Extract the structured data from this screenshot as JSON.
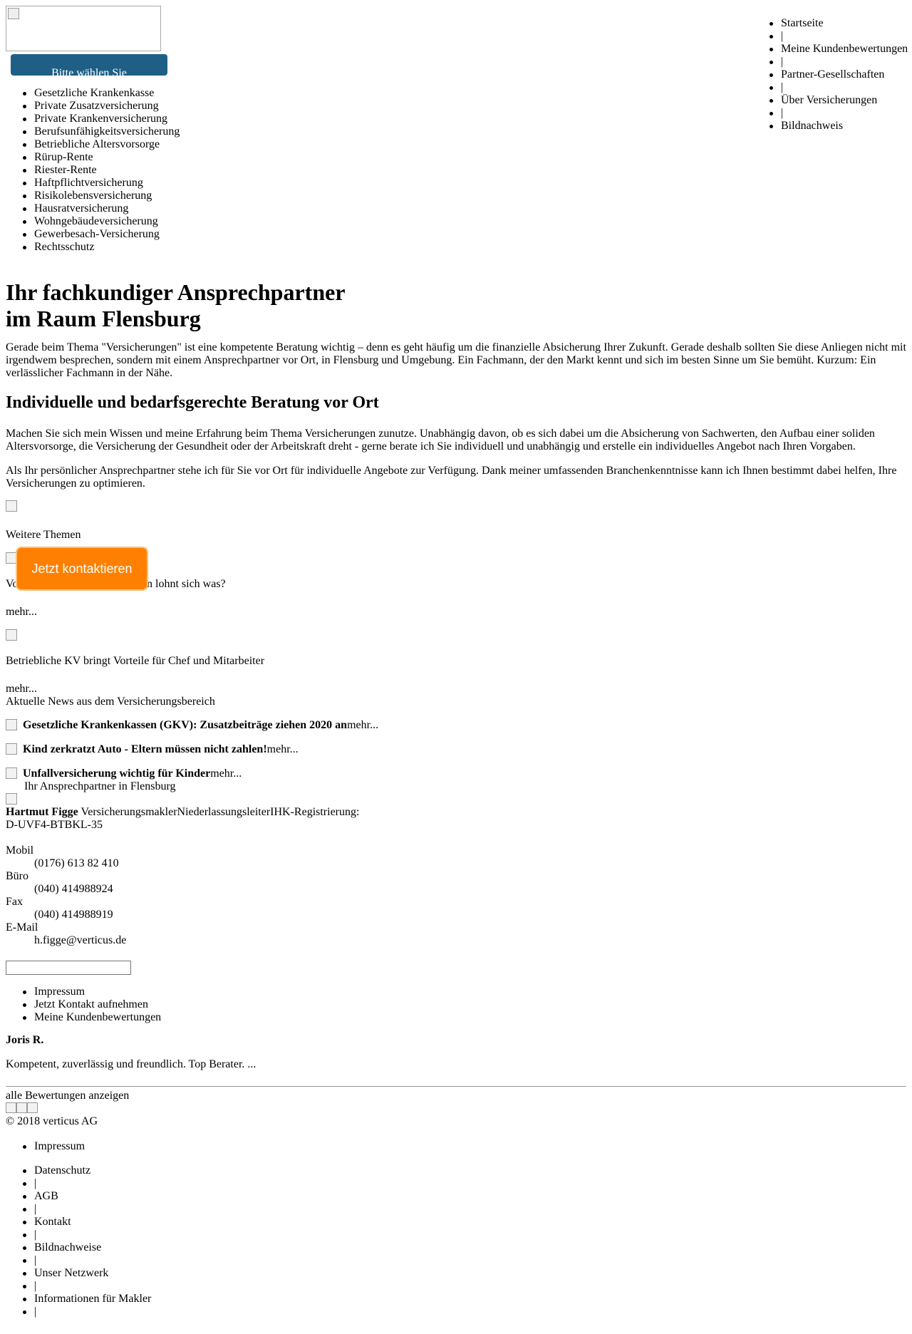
{
  "header": {
    "select_label": "Bitte wählen Sie"
  },
  "main_nav": [
    "Startseite",
    "|",
    "Meine Kundenbewertungen",
    "|",
    "Partner-Gesellschaften",
    "|",
    "Über Versicherungen",
    "|",
    "Bildnachweis"
  ],
  "sidebar_nav": [
    "Gesetzliche Krankenkasse",
    "Private Zusatzversicherung",
    "Private Krankenversicherung",
    "Berufsunfähigkeitsversicherung",
    "Betriebliche Altersvorsorge",
    "Rürup-Rente",
    "Riester-Rente",
    "Haftpflichtversicherung",
    "Risikolebensversicherung",
    "Hausratversicherung",
    "Wohngebäudeversicherung",
    "Gewerbesach-Versicherung",
    "Rechtsschutz"
  ],
  "hero": {
    "title_line1": "Ihr fachkundiger Ansprechpartner",
    "title_line2": "im Raum Flensburg",
    "intro": "Gerade beim Thema \"Versicherungen\" ist eine kompetente Beratung wichtig – denn es geht häufig um die finanzielle Absicherung Ihrer Zukunft. Gerade deshalb sollten Sie diese Anliegen nicht mit irgendwem besprechen, sondern mit einem Ansprechpartner vor Ort, in Flensburg und Umgebung. Ein Fachmann, der den Markt kennt und sich im besten Sinne um Sie bemüht. Kurzum: Ein verlässlicher Fachmann in der Nähe."
  },
  "section": {
    "heading": "Individuelle und bedarfsgerechte Beratung vor Ort",
    "para1": "Machen Sie sich mein Wissen und meine Erfahrung beim Thema Versicherungen zunutze. Unabhängig davon, ob es sich dabei um die Absicherung von Sachwerten, den Aufbau einer soliden Altersvorsorge, die Versicherung der Gesundheit oder der Arbeitskraft dreht - gerne berate ich Sie individuell und unabhängig und erstelle ein individuelles Angebot nach Ihren Vorgaben.",
    "para2": "Als Ihr persönlicher Ansprechpartner stehe ich für Sie vor Ort für individuelle Angebote zur Verfügung. Dank meiner umfassenden Branchenkenntnisse kann ich Ihnen bestimmt dabei helfen, Ihre Versicherungen zu optimieren."
  },
  "themes": {
    "label": "Weitere Themen",
    "item1_title_left": "Vo",
    "item1_title_right": "n lohnt sich was?",
    "item1_more": "mehr...",
    "item2_title": "Betriebliche KV bringt Vorteile für Chef und Mitarbeiter",
    "item2_more": "mehr..."
  },
  "contact_button": "Jetzt kontaktieren",
  "news": {
    "heading": "Aktuelle News aus dem Versicherungsbereich",
    "items": [
      {
        "title": "Gesetzliche Krankenkassen (GKV): Zusatzbeiträge ziehen 2020 an",
        "more": "mehr..."
      },
      {
        "title": "Kind zerkratzt Auto - Eltern müssen nicht zahlen!",
        "more": "mehr..."
      },
      {
        "title": "Unfallversicherung wichtig für Kinder",
        "more": "mehr..."
      }
    ],
    "subline": "Ihr Ansprechpartner in Flensburg"
  },
  "agent": {
    "name": "Hartmut Figge",
    "details": " VersicherungsmaklerNiederlassungsleiterIHK-Registrierung:",
    "reg": "D-UVF4-BTBKL-35",
    "mobil_label": "Mobil",
    "mobil": "(0176) 613 82 410",
    "buero_label": "Büro",
    "buero": "(040) 414988924",
    "fax_label": "Fax",
    "fax": "(040) 414988919",
    "email_label": "E-Mail",
    "email": "h.figge@verticus.de"
  },
  "search": {
    "value": ""
  },
  "agent_links": [
    "Impressum",
    "Jetzt Kontakt aufnehmen",
    "Meine Kundenbewertungen"
  ],
  "review": {
    "author": "Joris R.",
    "text": "Kompetent, zuverlässig und freundlich. Top Berater. ...",
    "all_link": "alle Bewertungen anzeigen"
  },
  "footer": {
    "copyright": "© 2018 verticus AG",
    "imprint": "Impressum",
    "links": [
      "Datenschutz",
      "|",
      "AGB",
      "|",
      "Kontakt",
      "|",
      "Bildnachweise",
      "|",
      "Unser Netzwerk",
      "|",
      "Informationen für Makler",
      "|"
    ]
  }
}
